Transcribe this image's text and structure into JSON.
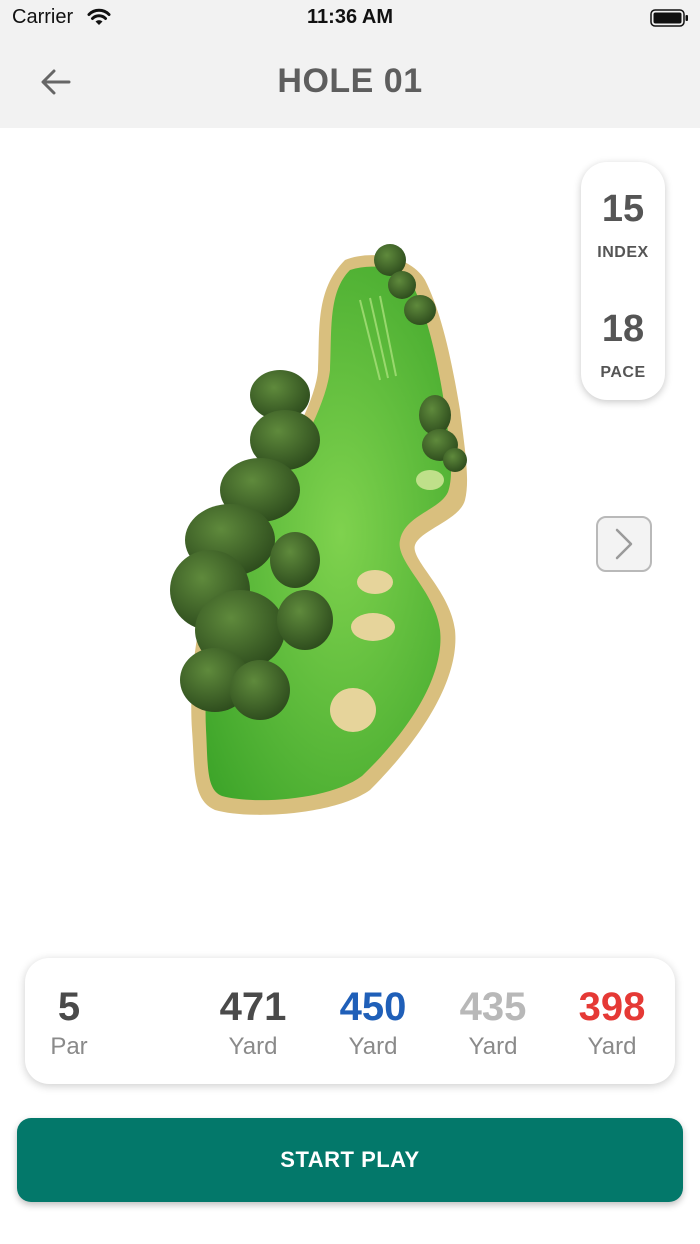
{
  "status_bar": {
    "carrier": "Carrier",
    "time": "11:36 AM"
  },
  "header": {
    "title": "HOLE 01",
    "back_icon": "arrow-left-icon",
    "background": "#f2f2f2",
    "title_color": "#5e5e5e"
  },
  "hole_info": {
    "index_value": "15",
    "index_label": "INDEX",
    "pace_value": "18",
    "pace_label": "PACE"
  },
  "next_icon": "chevron-right-icon",
  "yardage": {
    "par": {
      "value": "5",
      "label": "Par",
      "color": "#4a4a4a"
    },
    "tees": [
      {
        "value": "471",
        "label": "Yard",
        "color": "#4a4a4a"
      },
      {
        "value": "450",
        "label": "Yard",
        "color": "#1f5fb8"
      },
      {
        "value": "435",
        "label": "Yard",
        "color": "#b8b8b8"
      },
      {
        "value": "398",
        "label": "Yard",
        "color": "#e53935"
      }
    ]
  },
  "start_button": {
    "label": "START PLAY",
    "color": "#03786a"
  }
}
